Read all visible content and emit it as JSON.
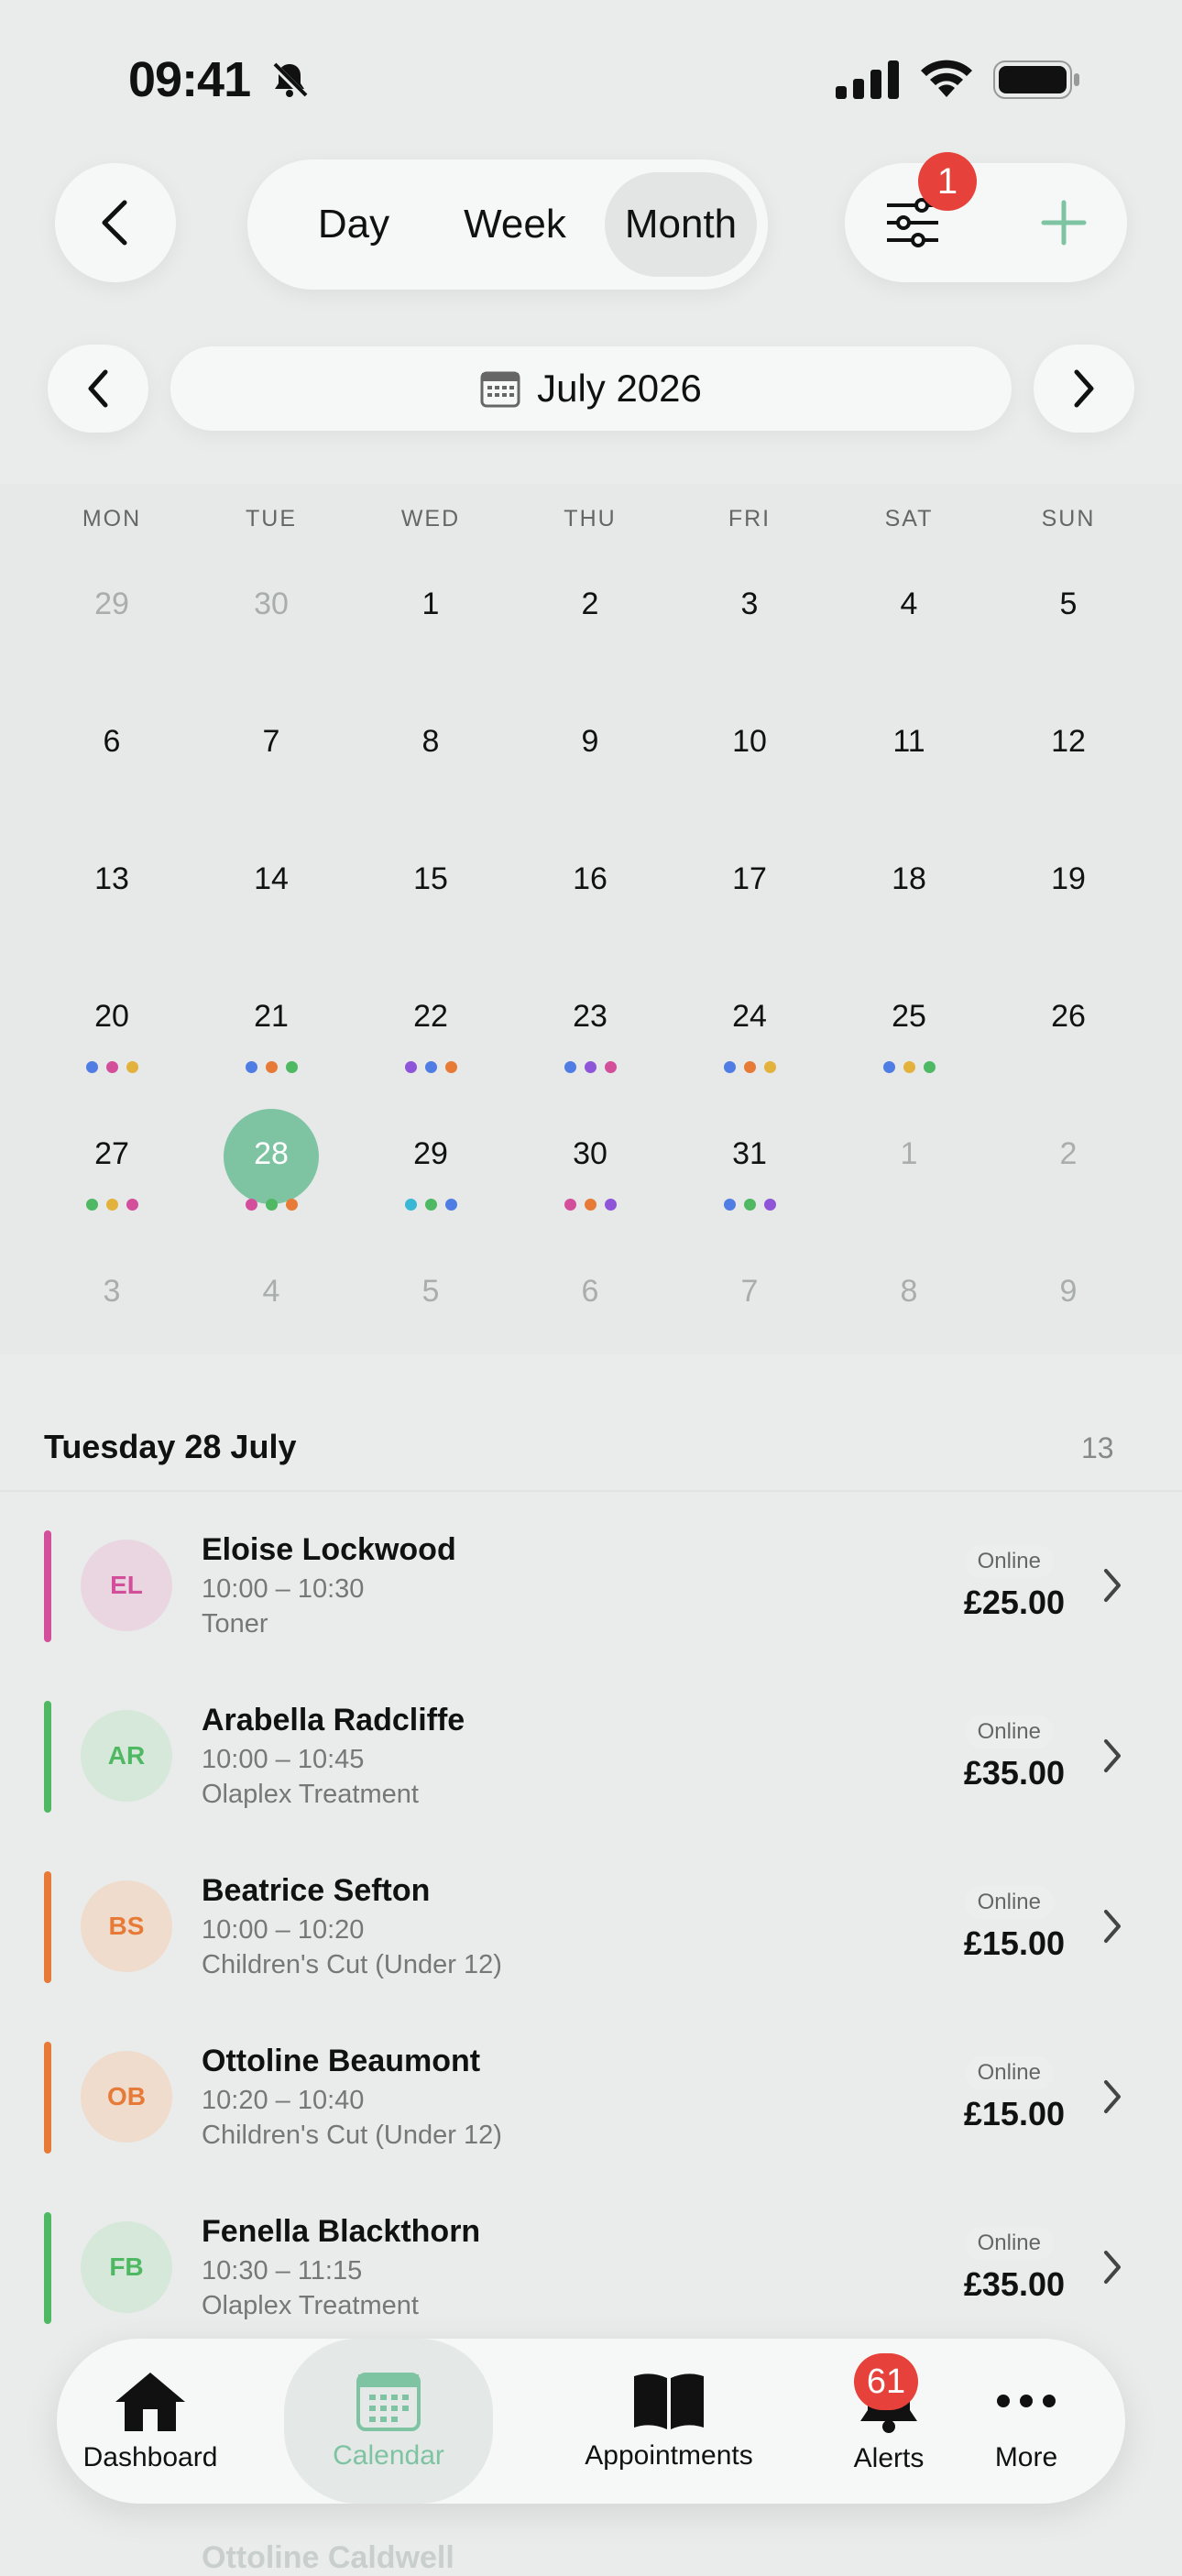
{
  "status": {
    "time": "09:41"
  },
  "header": {
    "view_tabs": [
      {
        "label": "Day",
        "active": false
      },
      {
        "label": "Week",
        "active": false
      },
      {
        "label": "Month",
        "active": true
      }
    ],
    "filter_badge": "1",
    "month_label": "July 2026"
  },
  "calendar": {
    "weekdays": [
      "MON",
      "TUE",
      "WED",
      "THU",
      "FRI",
      "SAT",
      "SUN"
    ],
    "weeks": [
      [
        {
          "d": "29",
          "muted": true
        },
        {
          "d": "30",
          "muted": true
        },
        {
          "d": "1"
        },
        {
          "d": "2"
        },
        {
          "d": "3"
        },
        {
          "d": "4"
        },
        {
          "d": "5"
        }
      ],
      [
        {
          "d": "6"
        },
        {
          "d": "7"
        },
        {
          "d": "8"
        },
        {
          "d": "9"
        },
        {
          "d": "10"
        },
        {
          "d": "11"
        },
        {
          "d": "12"
        }
      ],
      [
        {
          "d": "13"
        },
        {
          "d": "14"
        },
        {
          "d": "15"
        },
        {
          "d": "16"
        },
        {
          "d": "17"
        },
        {
          "d": "18"
        },
        {
          "d": "19"
        }
      ],
      [
        {
          "d": "20",
          "dots": [
            "#4f7de3",
            "#d34f9b",
            "#e3b23c"
          ]
        },
        {
          "d": "21",
          "dots": [
            "#4f7de3",
            "#e67a36",
            "#4fb862"
          ]
        },
        {
          "d": "22",
          "dots": [
            "#8e55d8",
            "#4f7de3",
            "#e67a36"
          ]
        },
        {
          "d": "23",
          "dots": [
            "#4f7de3",
            "#8e55d8",
            "#d34f9b"
          ]
        },
        {
          "d": "24",
          "dots": [
            "#4f7de3",
            "#e67a36",
            "#e3b23c"
          ]
        },
        {
          "d": "25",
          "dots": [
            "#4f7de3",
            "#e3b23c",
            "#4fb862"
          ]
        },
        {
          "d": "26"
        }
      ],
      [
        {
          "d": "27",
          "dots": [
            "#4fb862",
            "#e3b23c",
            "#d34f9b"
          ]
        },
        {
          "d": "28",
          "today": true,
          "dots": [
            "#d34f9b",
            "#4fb862",
            "#e67a36"
          ]
        },
        {
          "d": "29",
          "dots": [
            "#3bb7d6",
            "#4fb862",
            "#4f7de3"
          ]
        },
        {
          "d": "30",
          "dots": [
            "#d34f9b",
            "#e67a36",
            "#8e55d8"
          ]
        },
        {
          "d": "31",
          "dots": [
            "#4f7de3",
            "#4fb862",
            "#8e55d8"
          ]
        },
        {
          "d": "1",
          "muted": true
        },
        {
          "d": "2",
          "muted": true
        }
      ],
      [
        {
          "d": "3",
          "muted": true
        },
        {
          "d": "4",
          "muted": true
        },
        {
          "d": "5",
          "muted": true
        },
        {
          "d": "6",
          "muted": true
        },
        {
          "d": "7",
          "muted": true
        },
        {
          "d": "8",
          "muted": true
        },
        {
          "d": "9",
          "muted": true
        }
      ]
    ]
  },
  "list": {
    "title": "Tuesday 28 July",
    "count": "13",
    "appointments": [
      {
        "initials": "EL",
        "name": "Eloise Lockwood",
        "time": "10:00 – 10:30",
        "service": "Toner",
        "status": "Online",
        "price": "£25.00",
        "color": "#d34f9b",
        "avatar_bg": "#ead6e1"
      },
      {
        "initials": "AR",
        "name": "Arabella Radcliffe",
        "time": "10:00 – 10:45",
        "service": "Olaplex Treatment",
        "status": "Online",
        "price": "£35.00",
        "color": "#4fb862",
        "avatar_bg": "#d6e8da"
      },
      {
        "initials": "BS",
        "name": "Beatrice Sefton",
        "time": "10:00 – 10:20",
        "service": "Children's Cut (Under 12)",
        "status": "Online",
        "price": "£15.00",
        "color": "#e67a36",
        "avatar_bg": "#efdccd"
      },
      {
        "initials": "OB",
        "name": "Ottoline Beaumont",
        "time": "10:20 – 10:40",
        "service": "Children's Cut (Under 12)",
        "status": "Online",
        "price": "£15.00",
        "color": "#e67a36",
        "avatar_bg": "#efdccd"
      },
      {
        "initials": "FB",
        "name": "Fenella Blackthorn",
        "time": "10:30 – 11:15",
        "service": "Olaplex Treatment",
        "status": "Online",
        "price": "£35.00",
        "color": "#4fb862",
        "avatar_bg": "#d6e8da"
      }
    ],
    "faded_next": "Ottoline Caldwell"
  },
  "tabbar": {
    "items": [
      {
        "label": "Dashboard",
        "icon": "home-icon",
        "active": false
      },
      {
        "label": "Calendar",
        "icon": "calendar-icon",
        "active": true
      },
      {
        "label": "Appointments",
        "icon": "book-icon",
        "active": false
      },
      {
        "label": "Alerts",
        "icon": "bell-icon",
        "active": false,
        "badge": "61"
      },
      {
        "label": "More",
        "icon": "more-icon",
        "active": false
      }
    ]
  },
  "colors": {
    "accent": "#7ec4a3",
    "badge": "#e6413a"
  }
}
